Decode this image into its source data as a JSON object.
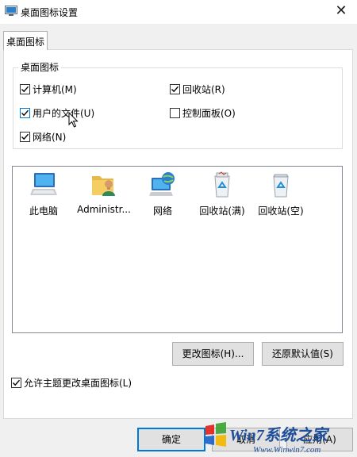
{
  "window": {
    "title": "桌面图标设置"
  },
  "tabs": [
    {
      "label": "桌面图标"
    }
  ],
  "desktop_icons_group": {
    "title": "桌面图标",
    "checkboxes": [
      {
        "label": "计算机(M)",
        "checked": true
      },
      {
        "label": "回收站(R)",
        "checked": true
      },
      {
        "label": "用户的文件(U)",
        "checked": true
      },
      {
        "label": "控制面板(O)",
        "checked": false
      },
      {
        "label": "网络(N)",
        "checked": true
      }
    ]
  },
  "icon_list": [
    {
      "label": "此电脑",
      "icon": "computer-icon"
    },
    {
      "label": "Administr...",
      "icon": "user-folder-icon"
    },
    {
      "label": "网络",
      "icon": "network-icon"
    },
    {
      "label": "回收站(满)",
      "icon": "recycle-bin-full-icon"
    },
    {
      "label": "回收站(空)",
      "icon": "recycle-bin-empty-icon"
    }
  ],
  "buttons": {
    "change_icon": "更改图标(H)...",
    "restore_default": "还原默认值(S)",
    "ok": "确定",
    "cancel": "取消",
    "apply": "应用(A)"
  },
  "allow_theme": {
    "label": "允许主题更改桌面图标(L)",
    "checked": true
  },
  "watermark": {
    "brand": "Win7系统之家",
    "url": "Www.Winwin7.com"
  },
  "colors": {
    "accent": "#0078d7",
    "win_red": "#e2231a",
    "win_green": "#3fa535",
    "win_blue": "#1e64c8",
    "win_yellow": "#f5b800"
  }
}
